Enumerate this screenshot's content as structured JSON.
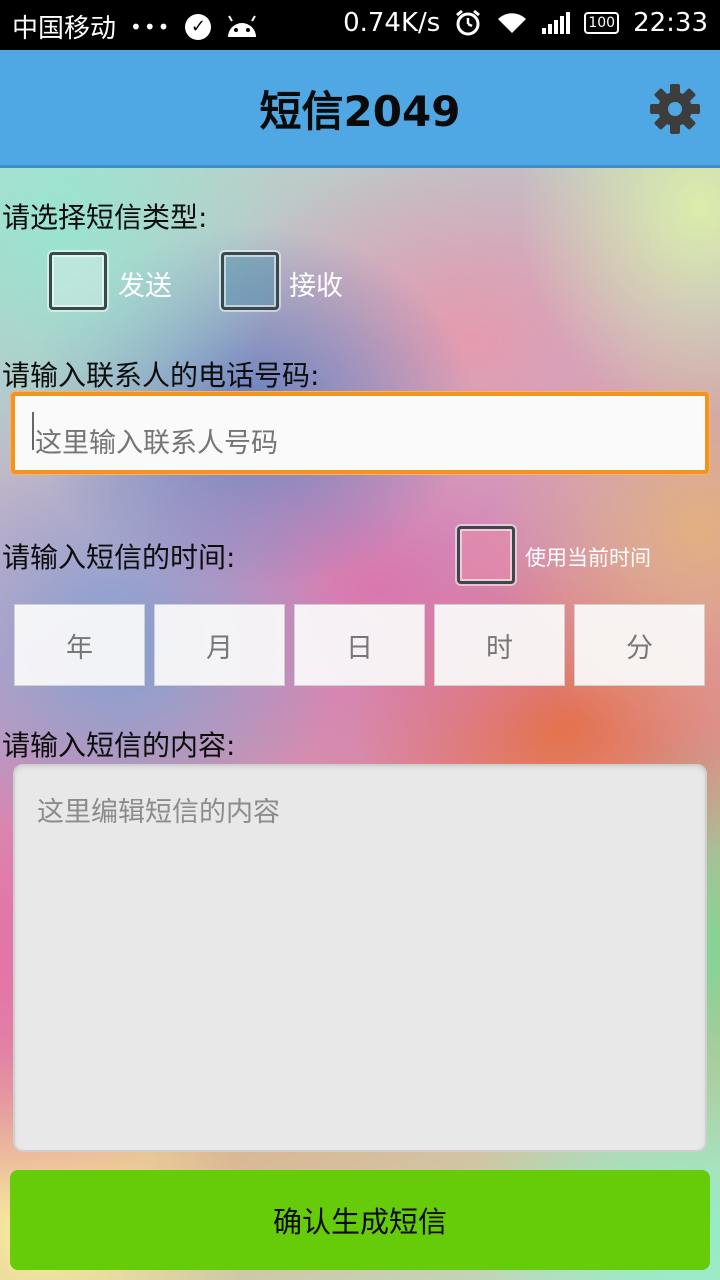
{
  "status_bar": {
    "carrier": "中国移动",
    "dots": "•••",
    "speed": "0.74K/s",
    "battery": "100",
    "time": "22:33",
    "icons": [
      "check-circle-icon",
      "android-icon",
      "alarm-icon",
      "wifi-icon",
      "signal-icon",
      "battery-icon"
    ]
  },
  "app_bar": {
    "title": "短信2049",
    "settings_icon": "gear-icon",
    "color": "#4fa8e3"
  },
  "form": {
    "type_label": "请选择短信类型:",
    "send_label": "发送",
    "receive_label": "接收",
    "phone_label": "请输入联系人的电话号码:",
    "phone_placeholder": "这里输入联系人号码",
    "phone_value": "",
    "time_label": "请输入短信的时间:",
    "use_current_time_label": "使用当前时间",
    "time_fields": {
      "year": "年",
      "month": "月",
      "day": "日",
      "hour": "时",
      "minute": "分"
    },
    "content_label": "请输入短信的内容:",
    "content_placeholder": "这里编辑短信的内容",
    "content_value": "",
    "submit_label": "确认生成短信",
    "submit_color": "#66cc0a",
    "focus_color": "#f39322"
  }
}
